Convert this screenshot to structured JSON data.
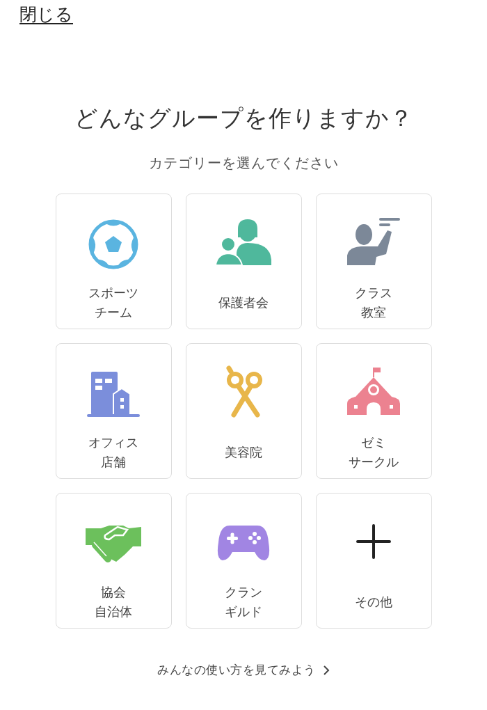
{
  "close_link": "閉じる",
  "title": "どんなグループを作りますか？",
  "subtitle": "カテゴリーを選んでください",
  "categories": [
    {
      "kind": "ball",
      "lines": [
        "スポーツ",
        "チーム"
      ]
    },
    {
      "kind": "parents",
      "lines": [
        "保護者会"
      ]
    },
    {
      "kind": "teacher",
      "lines": [
        "クラス",
        "教室"
      ]
    },
    {
      "kind": "office",
      "lines": [
        "オフィス",
        "店舗"
      ]
    },
    {
      "kind": "scissors",
      "lines": [
        "美容院"
      ]
    },
    {
      "kind": "school",
      "lines": [
        "ゼミ",
        "サークル"
      ]
    },
    {
      "kind": "handshake",
      "lines": [
        "協会",
        "自治体"
      ]
    },
    {
      "kind": "gamepad",
      "lines": [
        "クラン",
        "ギルド"
      ]
    },
    {
      "kind": "plus",
      "lines": [
        "その他"
      ]
    }
  ],
  "footer_link": "みんなの使い方を見てみよう"
}
